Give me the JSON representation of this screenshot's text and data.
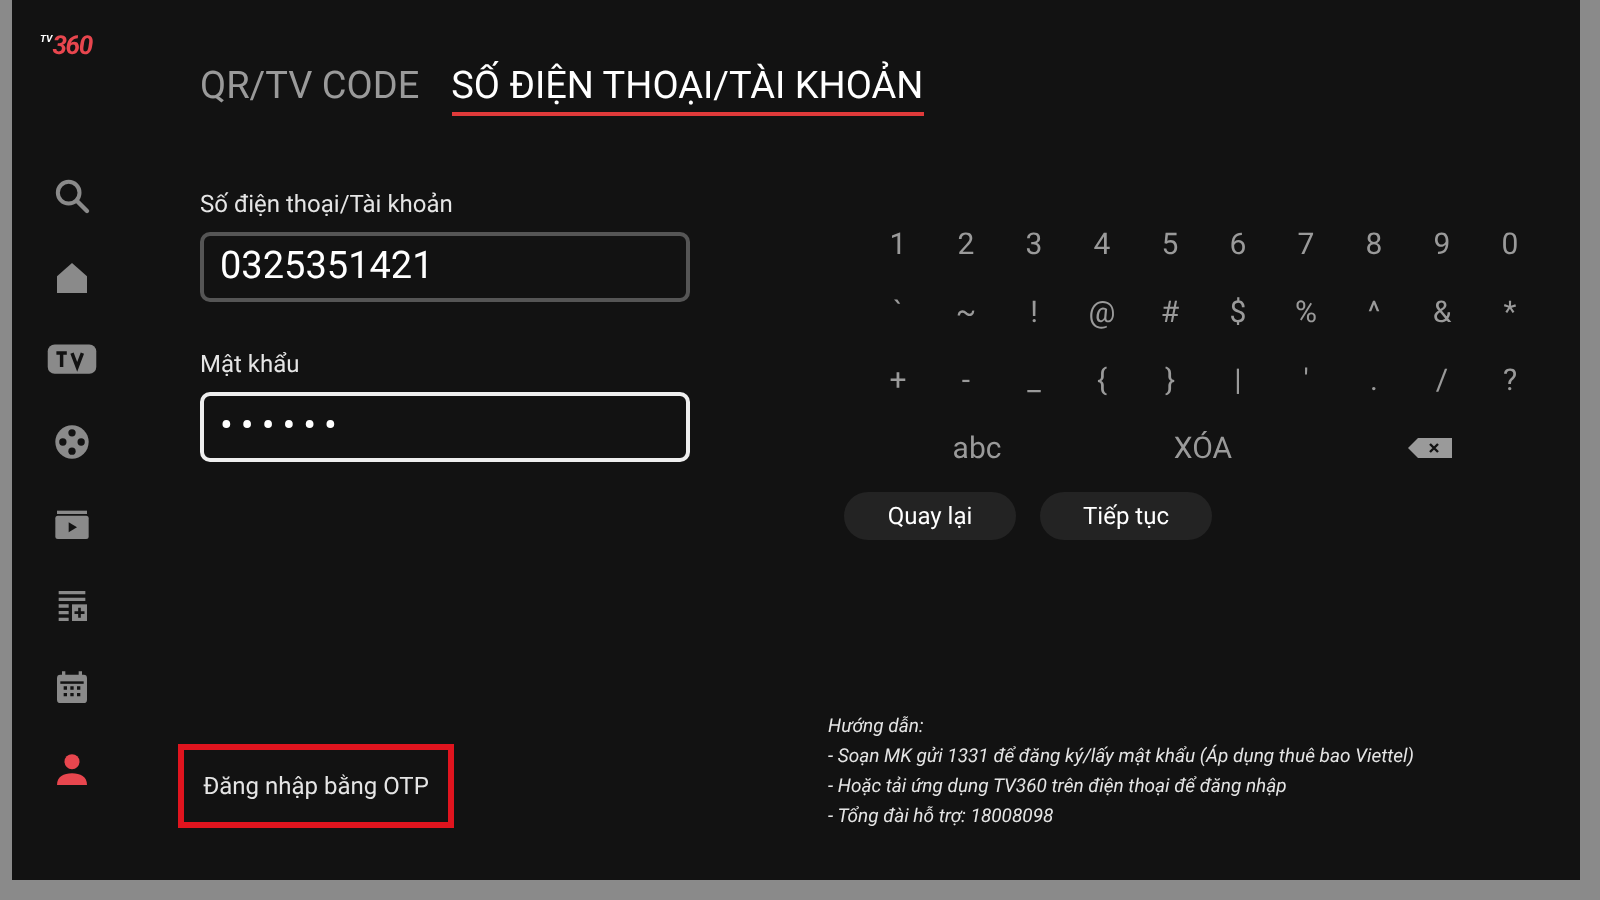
{
  "logo": {
    "small": "TV",
    "big": "360"
  },
  "sidebar": {
    "items": [
      {
        "kind": "search",
        "selected": false
      },
      {
        "kind": "home",
        "selected": false
      },
      {
        "kind": "tv",
        "selected": false
      },
      {
        "kind": "film",
        "selected": false
      },
      {
        "kind": "video",
        "selected": false
      },
      {
        "kind": "playlist",
        "selected": false
      },
      {
        "kind": "calendar",
        "selected": false
      },
      {
        "kind": "account",
        "selected": true
      }
    ]
  },
  "tabs": [
    {
      "label": "QR/TV CODE",
      "selected": false
    },
    {
      "label": "SỐ ĐIỆN THOẠI/TÀI KHOẢN",
      "selected": true
    }
  ],
  "form": {
    "fields": [
      {
        "label": "Số điện thoại/Tài khoản",
        "value": "0325351421",
        "focused": false
      },
      {
        "label": "Mật khẩu",
        "value": "••••••",
        "focused": true
      }
    ]
  },
  "otp_link": {
    "label": "Đăng nhập bằng OTP",
    "highlighted": true
  },
  "keyboard": {
    "rows": [
      [
        "1",
        "2",
        "3",
        "4",
        "5",
        "6",
        "7",
        "8",
        "9",
        "0"
      ],
      [
        "`",
        "~",
        "!",
        "@",
        "#",
        "$",
        "%",
        "^",
        "&",
        "*"
      ],
      [
        "+",
        "-",
        "_",
        "{",
        "}",
        "|",
        "'",
        ".",
        "/",
        "?"
      ]
    ],
    "actions": [
      {
        "kind": "text",
        "label": "abc"
      },
      {
        "kind": "text",
        "label": "XÓA"
      },
      {
        "kind": "backspace"
      }
    ]
  },
  "buttons": [
    "Quay lại",
    "Tiếp tục"
  ],
  "help": {
    "title": "Hướng dẫn:",
    "lines": [
      "- Soạn MK gửi 1331 để đăng ký/lấy mật khẩu (Áp dụng thuê bao Viettel)",
      "- Hoặc tải ứng dụng TV360 trên điện thoại để đăng nhập",
      "- Tổng đài hỗ trợ: 18008098"
    ]
  }
}
